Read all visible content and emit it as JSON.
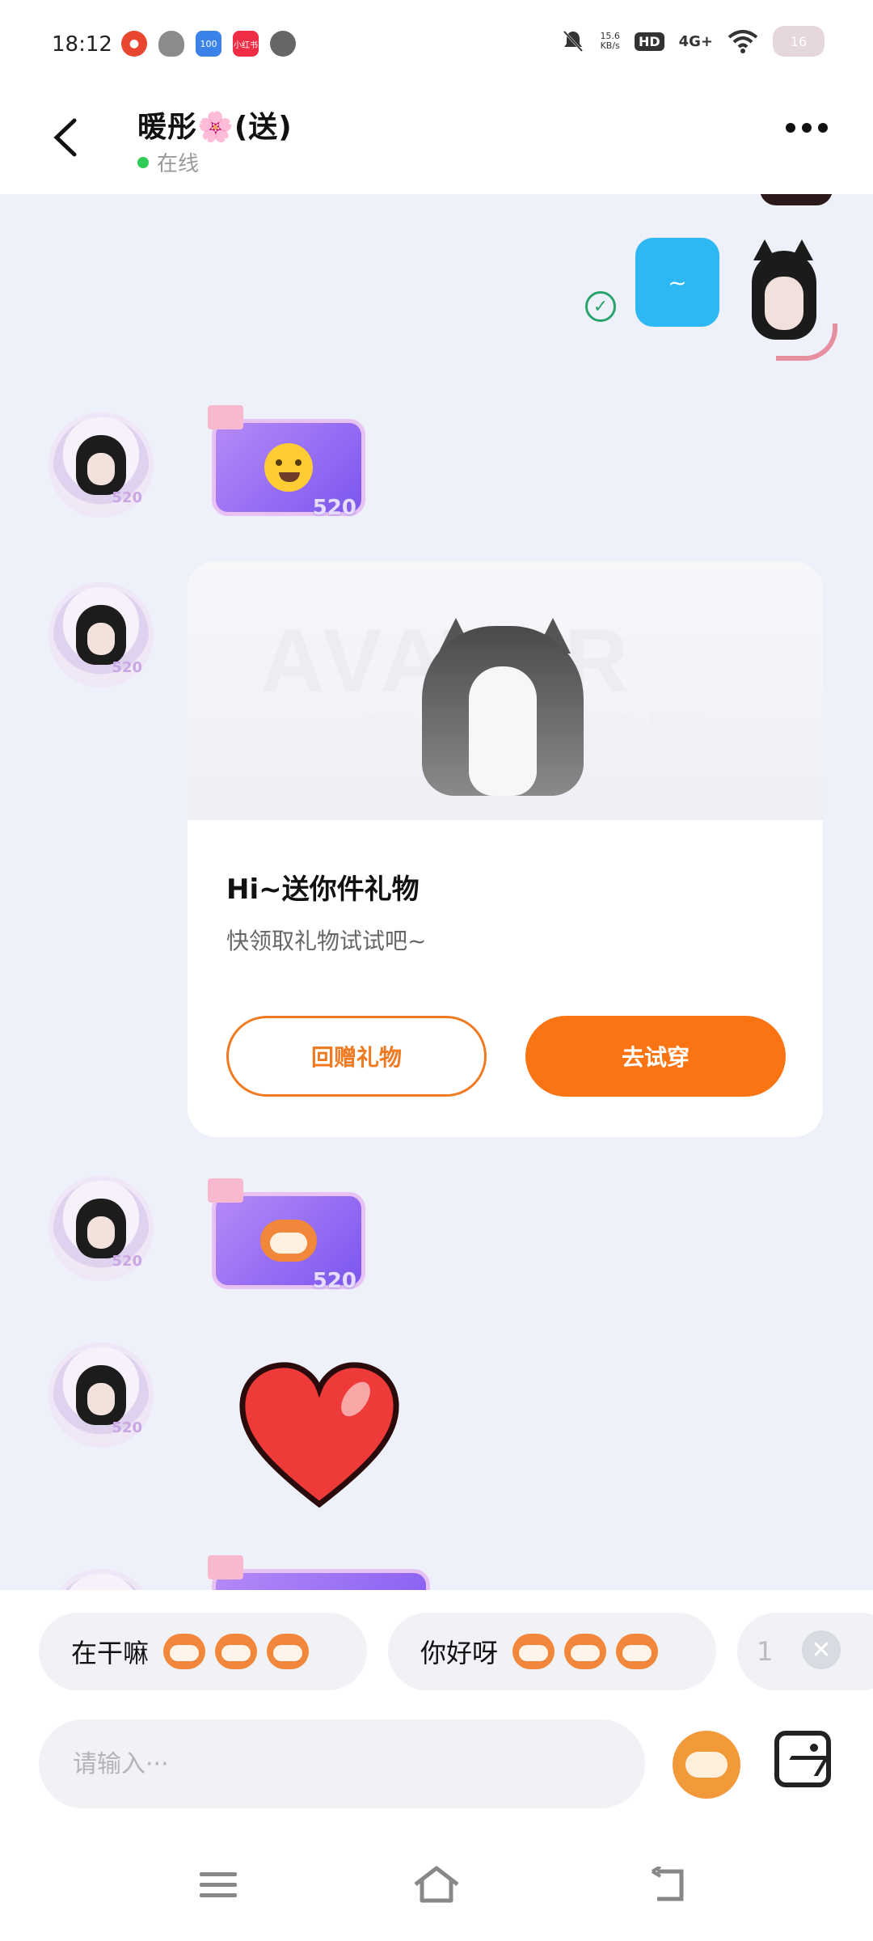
{
  "status_bar": {
    "time": "18:12",
    "net_speed_value": "15.6",
    "net_speed_unit": "KB/s",
    "hd": "HD",
    "signal": "4G+",
    "battery": "16",
    "app_badges": [
      "100",
      "小红书"
    ]
  },
  "header": {
    "title": "暖彤🌸(送)",
    "status": "在线"
  },
  "messages": {
    "sent_text": "~",
    "avatar_badge": "520",
    "gift_badge": "520",
    "gift_card": {
      "watermark_line1": "AVATAR",
      "watermark_line2": "STORE",
      "title": "Hi~送你件礼物",
      "subtitle": "快领取礼物试试吧~",
      "btn_return": "回赠礼物",
      "btn_try": "去试穿"
    }
  },
  "quick_replies": [
    {
      "label": "在干嘛"
    },
    {
      "label": "你好呀"
    },
    {
      "label": "1"
    }
  ],
  "input": {
    "placeholder": "请输入···"
  },
  "colors": {
    "accent": "#fb7413",
    "sent_bubble": "#2eb8f3",
    "online": "#2ecc56"
  }
}
